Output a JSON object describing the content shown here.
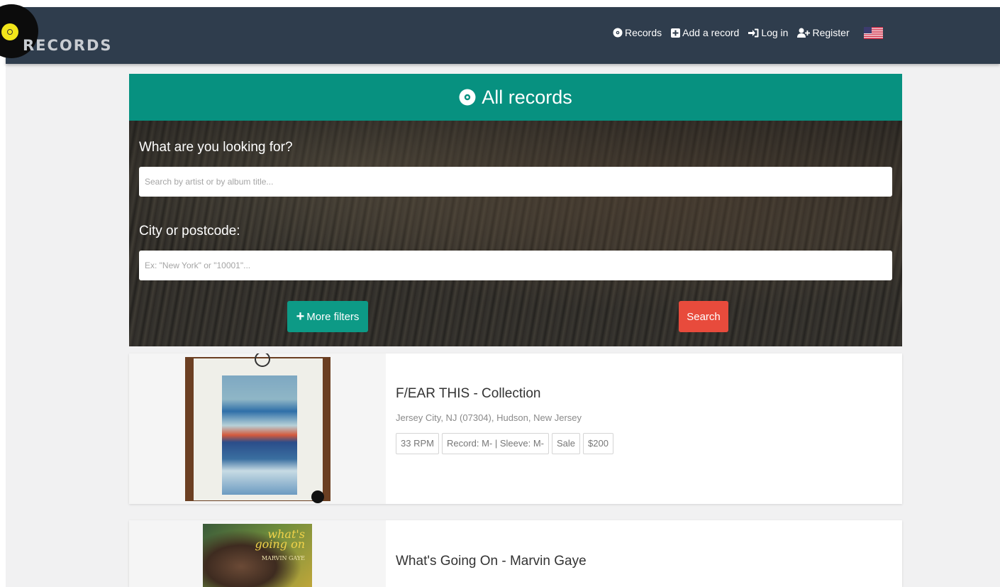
{
  "brand": {
    "name": "RECORDS"
  },
  "nav": {
    "items": [
      {
        "label": "Records",
        "icon": "record-icon"
      },
      {
        "label": "Add a record",
        "icon": "plus-square-icon"
      },
      {
        "label": "Log in",
        "icon": "sign-in-icon"
      },
      {
        "label": "Register",
        "icon": "user-plus-icon"
      }
    ],
    "language_icon": "us-flag-icon"
  },
  "search": {
    "title": "All records",
    "query_label": "What are you looking for?",
    "query_placeholder": "Search by artist or by album title...",
    "location_label": "City or postcode:",
    "location_placeholder": "Ex: \"New York\" or \"10001\"...",
    "filters_button": "More filters",
    "search_button": "Search"
  },
  "records": [
    {
      "title": "F/EAR THIS - Collection",
      "location": "Jersey City, NJ (07304), Hudson, New Jersey",
      "tags": [
        "33 RPM",
        "Record: M- | Sleeve: M-",
        "Sale",
        "$200"
      ]
    },
    {
      "title": "What's Going On - Marvin Gaye",
      "cover_title_line1": "what's",
      "cover_title_line2": "going on",
      "cover_artist": "MARVIN GAYE"
    }
  ],
  "colors": {
    "navbar": "#2f3d4d",
    "accent": "#079180",
    "search_button": "#e84b3c",
    "filters_button": "#0d9a86"
  }
}
